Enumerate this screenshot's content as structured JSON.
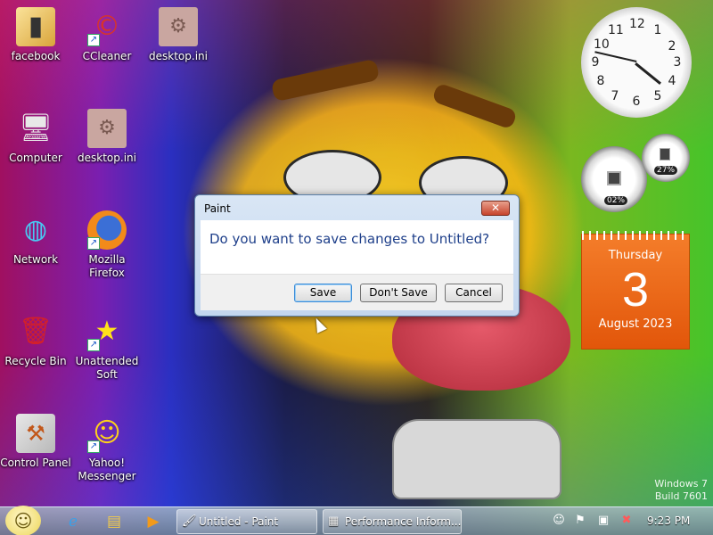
{
  "desktop": {
    "icons": [
      {
        "label": "facebook",
        "icon": "facebook-folder-icon"
      },
      {
        "label": "CCleaner",
        "icon": "ccleaner-icon"
      },
      {
        "label": "desktop.ini",
        "icon": "ini-file-icon"
      },
      {
        "label": "Computer",
        "icon": "computer-icon"
      },
      {
        "label": "desktop.ini",
        "icon": "ini-file-icon"
      },
      {
        "label": "Network",
        "icon": "network-icon"
      },
      {
        "label": "Mozilla Firefox",
        "icon": "firefox-icon"
      },
      {
        "label": "Recycle Bin",
        "icon": "recycle-bin-icon"
      },
      {
        "label": "Unattended Soft",
        "icon": "star-icon"
      },
      {
        "label": "Control Panel",
        "icon": "control-panel-icon"
      },
      {
        "label": "Yahoo! Messenger",
        "icon": "yahoo-messenger-icon"
      }
    ]
  },
  "gadgets": {
    "clock": {
      "time": "9:23",
      "numbers": [
        "12",
        "1",
        "2",
        "3",
        "4",
        "5",
        "6",
        "7",
        "8",
        "9",
        "10",
        "11"
      ]
    },
    "meters": {
      "cpu": "02%",
      "memory": "27%",
      "cpu_value": 0.02,
      "memory_value": 0.27
    },
    "calendar": {
      "weekday": "Thursday",
      "day": "3",
      "month_year": "August 2023"
    }
  },
  "dialog": {
    "title": "Paint",
    "message": "Do you want to save changes to Untitled?",
    "buttons": {
      "save": "Save",
      "dont_save": "Don't Save",
      "cancel": "Cancel"
    }
  },
  "taskbar": {
    "windows": [
      {
        "label": "Untitled - Paint",
        "icon": "paint-icon"
      },
      {
        "label": "Performance Inform...",
        "icon": "performance-icon"
      }
    ],
    "clock": "9:23 PM"
  },
  "watermark": {
    "line1": "Windows 7",
    "line2": "Build 7601"
  }
}
